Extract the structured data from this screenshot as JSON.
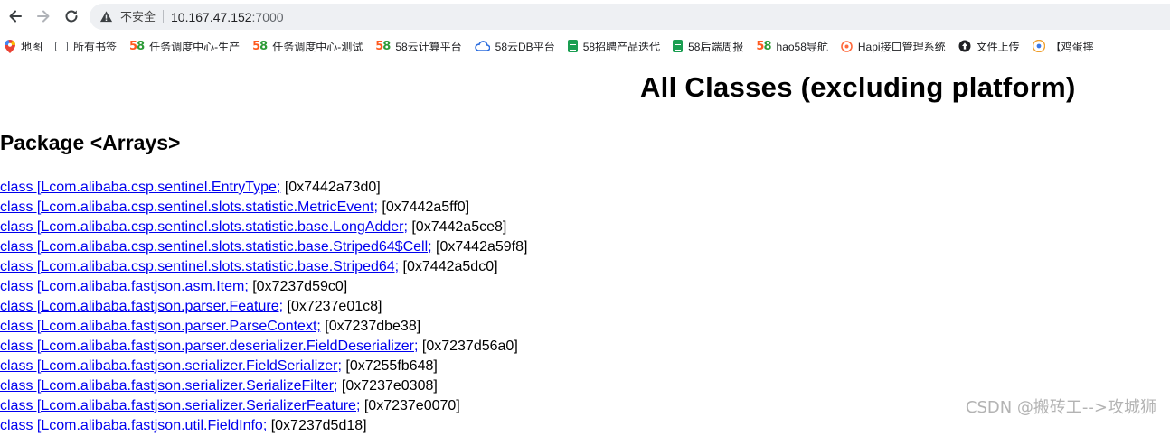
{
  "browser": {
    "security_label": "不安全",
    "url_host": "10.167.47.152",
    "url_port": ":7000"
  },
  "bookmarks": [
    {
      "icon": "map-pin-icon",
      "label": "地图"
    },
    {
      "icon": "folder-icon",
      "label": "所有书签"
    },
    {
      "icon": "58-logo-icon",
      "label": "任务调度中心-生产"
    },
    {
      "icon": "58-logo-icon",
      "label": "任务调度中心-测试"
    },
    {
      "icon": "58-logo-icon",
      "label": "58云计算平台"
    },
    {
      "icon": "cloud-db-icon",
      "label": "58云DB平台"
    },
    {
      "icon": "sheet-icon",
      "label": "58招聘产品迭代"
    },
    {
      "icon": "sheet-icon",
      "label": "58后端周报"
    },
    {
      "icon": "58-logo-icon",
      "label": "hao58导航"
    },
    {
      "icon": "hapi-icon",
      "label": "Hapi接口管理系统"
    },
    {
      "icon": "upload-globe-icon",
      "label": "文件上传"
    },
    {
      "icon": "chrome-icon",
      "label": "【鸡蛋摔"
    }
  ],
  "page": {
    "title": "All Classes (excluding platform)",
    "package_heading": "Package <Arrays>"
  },
  "classes": [
    {
      "link": "class [Lcom.alibaba.csp.sentinel.EntryType;",
      "addr": " [0x7442a73d0]"
    },
    {
      "link": "class [Lcom.alibaba.csp.sentinel.slots.statistic.MetricEvent;",
      "addr": " [0x7442a5ff0]"
    },
    {
      "link": "class [Lcom.alibaba.csp.sentinel.slots.statistic.base.LongAdder;",
      "addr": " [0x7442a5ce8]"
    },
    {
      "link": "class [Lcom.alibaba.csp.sentinel.slots.statistic.base.Striped64$Cell;",
      "addr": " [0x7442a59f8]"
    },
    {
      "link": "class [Lcom.alibaba.csp.sentinel.slots.statistic.base.Striped64;",
      "addr": " [0x7442a5dc0]"
    },
    {
      "link": "class [Lcom.alibaba.fastjson.asm.Item;",
      "addr": " [0x7237d59c0]"
    },
    {
      "link": "class [Lcom.alibaba.fastjson.parser.Feature;",
      "addr": " [0x7237e01c8]"
    },
    {
      "link": "class [Lcom.alibaba.fastjson.parser.ParseContext;",
      "addr": " [0x7237dbe38]"
    },
    {
      "link": "class [Lcom.alibaba.fastjson.parser.deserializer.FieldDeserializer;",
      "addr": " [0x7237d56a0]"
    },
    {
      "link": "class [Lcom.alibaba.fastjson.serializer.FieldSerializer;",
      "addr": " [0x7255fb648]"
    },
    {
      "link": "class [Lcom.alibaba.fastjson.serializer.SerializeFilter;",
      "addr": " [0x7237e0308]"
    },
    {
      "link": "class [Lcom.alibaba.fastjson.serializer.SerializerFeature;",
      "addr": " [0x7237e0070]"
    },
    {
      "link": "class [Lcom.alibaba.fastjson.util.FieldInfo;",
      "addr": " [0x7237d5d18]"
    }
  ],
  "watermark": "CSDN @搬砖工-->攻城狮"
}
